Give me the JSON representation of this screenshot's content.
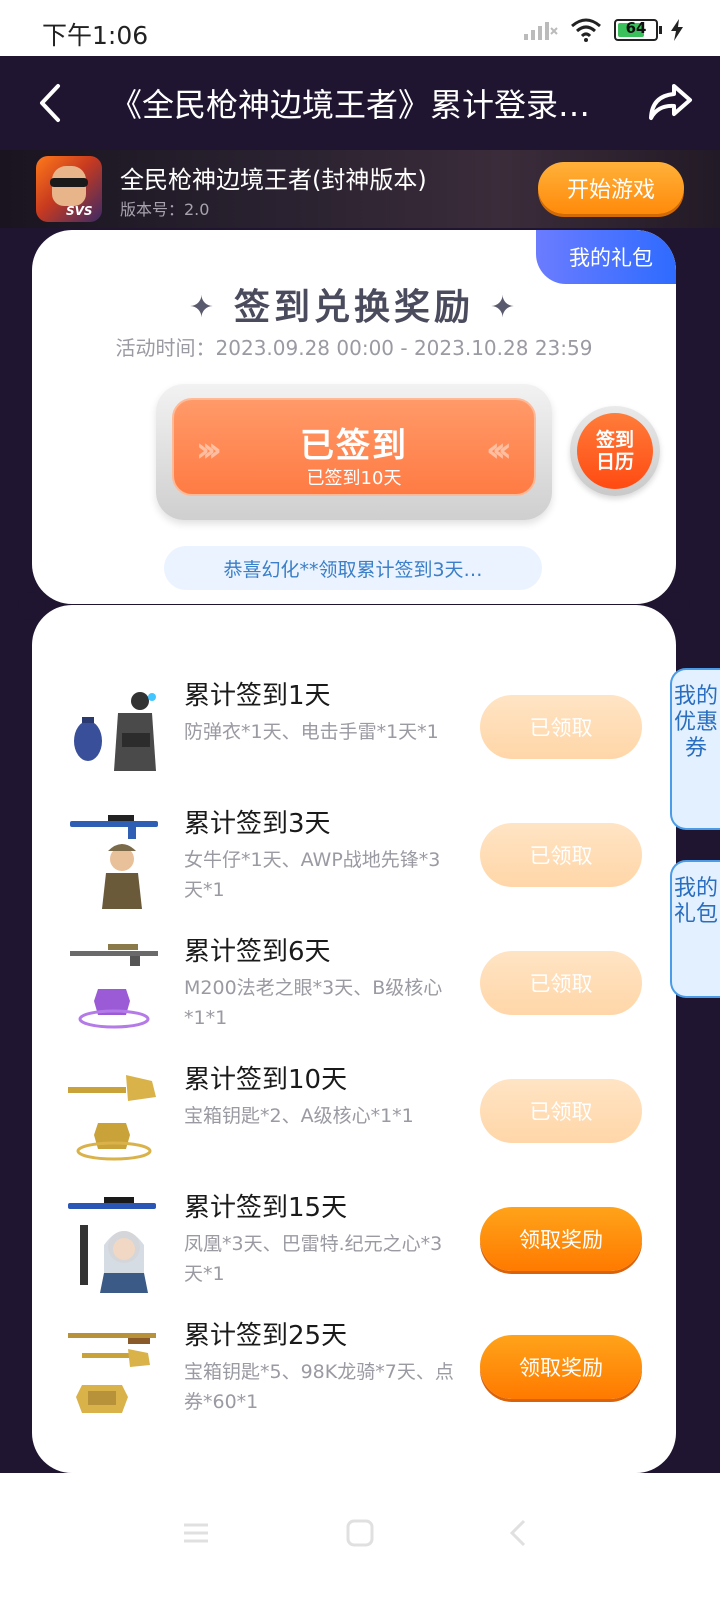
{
  "status_bar": {
    "time": "下午1:06",
    "battery": "64"
  },
  "header": {
    "title": "《全民枪神边境王者》累计登录…"
  },
  "game": {
    "name": "全民枪神边境王者(封神版本)",
    "version": "版本号：2.0",
    "icon_text": "SVS",
    "start_label": "开始游戏"
  },
  "checkin_card": {
    "my_gift_tab": "我的礼包",
    "title": "签到兑换奖励",
    "activity_time": "活动时间：2023.09.28 00:00 - 2023.10.28 23:59",
    "button_main": "已签到",
    "button_sub": "已签到10天",
    "calendar_label": "签到日历",
    "notice": "恭喜幻化**领取累计签到3天…"
  },
  "rewards": [
    {
      "title": "累计签到1天",
      "desc": "防弹衣*1天、电击手雷*1天*1",
      "button": "已领取",
      "state": "claimed"
    },
    {
      "title": "累计签到3天",
      "desc": "女牛仔*1天、AWP战地先锋*3天*1",
      "button": "已领取",
      "state": "claimed"
    },
    {
      "title": "累计签到6天",
      "desc": "M200法老之眼*3天、B级核心*1*1",
      "button": "已领取",
      "state": "claimed"
    },
    {
      "title": "累计签到10天",
      "desc": "宝箱钥匙*2、A级核心*1*1",
      "button": "已领取",
      "state": "claimed"
    },
    {
      "title": "累计签到15天",
      "desc": "凤凰*3天、巴雷特.纪元之心*3天*1",
      "button": "领取奖励",
      "state": "claimable"
    },
    {
      "title": "累计签到25天",
      "desc": "宝箱钥匙*5、98K龙骑*7天、点券*60*1",
      "button": "领取奖励",
      "state": "claimable"
    }
  ],
  "side_tabs": {
    "coupons": "我的优惠券",
    "gifts": "我的礼包"
  },
  "icons": {
    "back": "chevron-left-icon",
    "share": "share-icon",
    "signal": "signal-icon",
    "wifi": "wifi-icon",
    "battery": "battery-icon",
    "charging": "lightning-icon",
    "nav_menu": "menu-icon",
    "nav_home": "home-icon",
    "nav_back": "back-icon"
  },
  "colors": {
    "header_bg": "#1f1530",
    "accent_orange": "#ff8a0a",
    "claimed_btn": "#ffd6a8",
    "blue_tab": "#2e6bff"
  }
}
